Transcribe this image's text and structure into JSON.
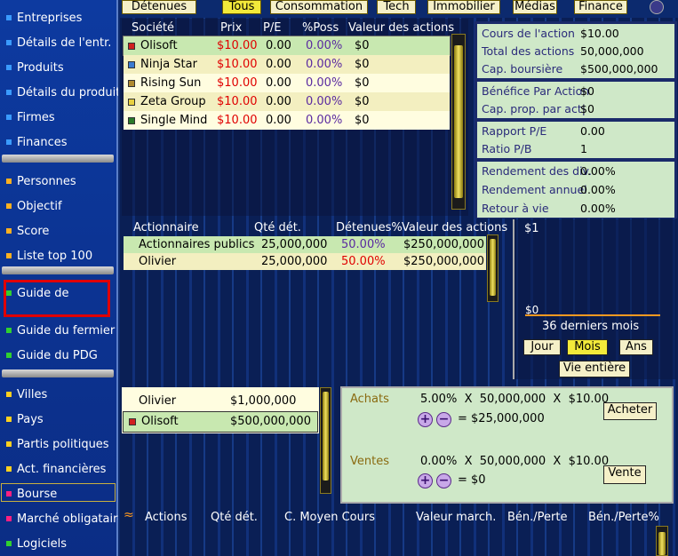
{
  "sidebar": {
    "items": [
      {
        "label": "Entreprises",
        "color": "#3a9bff"
      },
      {
        "label": "Détails de l'entr.",
        "color": "#3a9bff"
      },
      {
        "label": "Produits",
        "color": "#3a9bff"
      },
      {
        "label": "Détails du produit",
        "color": "#3a9bff"
      },
      {
        "label": "Firmes",
        "color": "#3a9bff"
      },
      {
        "label": "Finances",
        "color": "#3a9bff"
      },
      {
        "label": "Personnes",
        "color": "#ffb020"
      },
      {
        "label": "Objectif",
        "color": "#ffb020"
      },
      {
        "label": "Score",
        "color": "#ffb020"
      },
      {
        "label": "Liste top 100",
        "color": "#ffb020"
      },
      {
        "label": "Guide de",
        "color": "#30d030"
      },
      {
        "label": "Guide du fermier",
        "color": "#30d030"
      },
      {
        "label": "Guide du PDG",
        "color": "#30d030"
      },
      {
        "label": "Villes",
        "color": "#ffd020"
      },
      {
        "label": "Pays",
        "color": "#ffd020"
      },
      {
        "label": "Partis politiques",
        "color": "#ffd020"
      },
      {
        "label": "Act. financières",
        "color": "#ffd020"
      },
      {
        "label": "Bourse",
        "color": "#ff2080"
      },
      {
        "label": "Marché obligataire",
        "color": "#ff2080"
      },
      {
        "label": "Logiciels",
        "color": "#30d030"
      }
    ]
  },
  "tabs": [
    "Détenues",
    "Tous",
    "Consommation",
    "Tech",
    "Immobilier",
    "Médias",
    "Finance"
  ],
  "stocks": {
    "headers": [
      "Société",
      "Prix",
      "P/E",
      "%Poss",
      "Valeur des actions"
    ],
    "rows": [
      [
        "Olisoft",
        "$10.00",
        "0.00",
        "0.00%",
        "$0"
      ],
      [
        "Ninja Star",
        "$10.00",
        "0.00",
        "0.00%",
        "$0"
      ],
      [
        "Rising Sun",
        "$10.00",
        "0.00",
        "0.00%",
        "$0"
      ],
      [
        "Zeta Group",
        "$10.00",
        "0.00",
        "0.00%",
        "$0"
      ],
      [
        "Single Mind",
        "$10.00",
        "0.00",
        "0.00%",
        "$0"
      ]
    ],
    "colors": [
      "#d02020",
      "#3a7ad0",
      "#b08a30",
      "#e8d040",
      "#2a7a2a"
    ]
  },
  "info": [
    [
      "Cours de l'action",
      "$10.00"
    ],
    [
      "Total des actions",
      "50,000,000"
    ],
    [
      "Cap. boursière",
      "$500,000,000"
    ],
    [
      "Bénéfice Par Action",
      "$0"
    ],
    [
      "Cap. prop. par act|",
      "$0"
    ],
    [
      "Rapport P/E",
      "0.00"
    ],
    [
      "Ratio P/B",
      "1"
    ],
    [
      "Rendement des div.",
      "0.00%"
    ],
    [
      "Rendement annuel",
      "0.00%"
    ],
    [
      "Retour à vie",
      "0.00%"
    ]
  ],
  "holders": {
    "headers": [
      "Actionnaire",
      "Qté dét.",
      "Détenues%",
      "Valeur des actions"
    ],
    "rows": [
      [
        "Actionnaires publics",
        "25,000,000",
        "50.00%",
        "$250,000,000"
      ],
      [
        "Olivier",
        "25,000,000",
        "50.00%",
        "$250,000,000"
      ]
    ]
  },
  "chart": {
    "top": "$1",
    "bottom": "$0",
    "caption": "36 derniers mois",
    "buttons": [
      "Jour",
      "Mois",
      "Ans"
    ],
    "all": "Vie entière"
  },
  "cash": [
    [
      "Olivier",
      "$1,000,000"
    ],
    [
      "Olisoft",
      "$500,000,000"
    ]
  ],
  "trade": {
    "buy_label": "Achats",
    "buy_line": "5.00%  X  50,000,000  X  $10.00",
    "buy_total": "= $25,000,000",
    "buy_btn": "Acheter",
    "sell_label": "Ventes",
    "sell_line": "0.00%  X  50,000,000  X  $10.00",
    "sell_total": "= $0",
    "sell_btn": "Vente"
  },
  "portfolio": {
    "headers": [
      "Actions",
      "Qté dét.",
      "C. Moyen Cours",
      "Valeur march.",
      "Bén./Perte",
      "Bén./Perte%"
    ]
  }
}
